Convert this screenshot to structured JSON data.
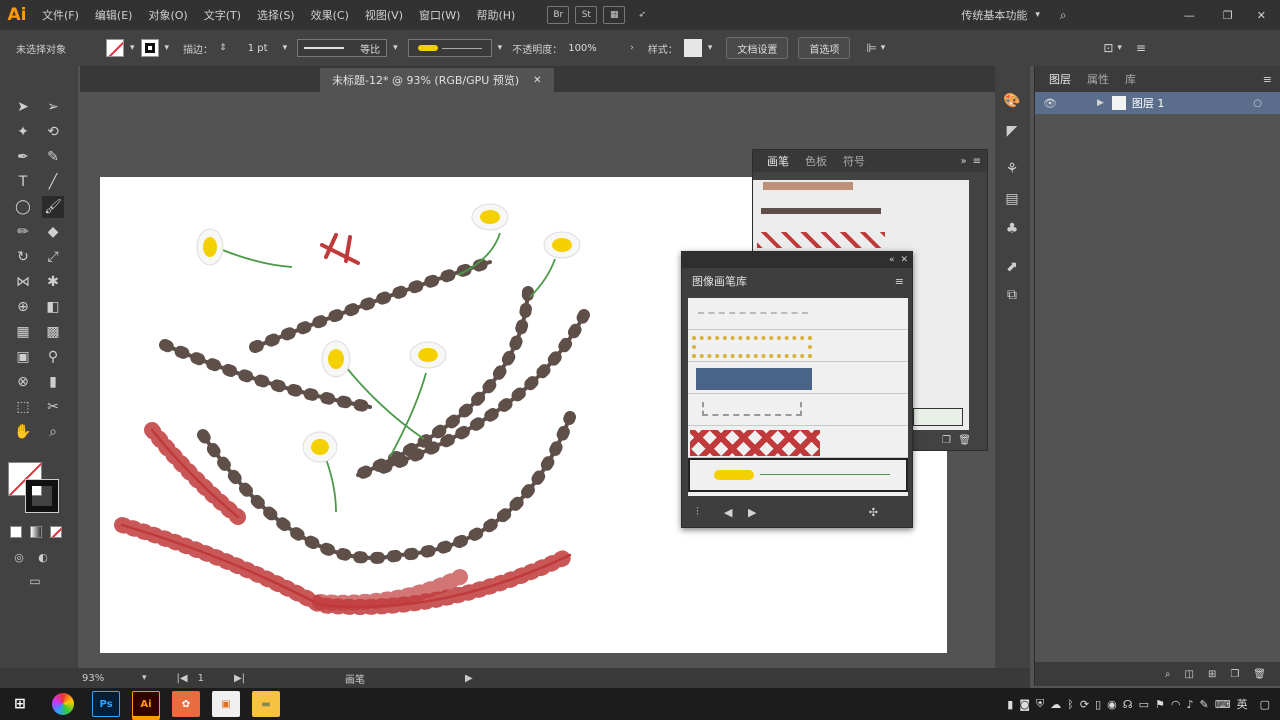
{
  "app": {
    "logo": "Ai"
  },
  "menu": [
    "文件(F)",
    "编辑(E)",
    "对象(O)",
    "文字(T)",
    "选择(S)",
    "效果(C)",
    "视图(V)",
    "窗口(W)",
    "帮助(H)"
  ],
  "menu_buttons": {
    "bridge": "Br",
    "stock": "St"
  },
  "workspace": {
    "label": "传统基本功能"
  },
  "control_bar": {
    "selection_status": "未选择对象",
    "stroke_label": "描边：",
    "stroke_value": "1 pt",
    "stroke_profile": "等比",
    "opacity_label": "不透明度：",
    "opacity_value": "100%",
    "style_label": "样式：",
    "doc_settings": "文档设置",
    "preferences": "首选项"
  },
  "document_tab": {
    "title": "未标题-12* @ 93% (RGB/GPU 预览)"
  },
  "layers_panel": {
    "tabs": [
      "图层",
      "属性",
      "库"
    ],
    "layer_name": "图层 1"
  },
  "brush_panel": {
    "tabs": [
      "画笔",
      "色板",
      "符号"
    ]
  },
  "library_panel": {
    "title": "图像画笔库"
  },
  "status_bar": {
    "zoom": "93%",
    "page": "1",
    "tool": "画笔"
  },
  "taskbar": {
    "apps": [
      "Ps",
      "Ai"
    ],
    "ime": "英"
  },
  "colors": {
    "accent_ai": "#ff9a00",
    "rail": "#5e4f49",
    "cross": "#c0393b",
    "stem": "#4b9a47",
    "petal_center": "#f4d000"
  }
}
